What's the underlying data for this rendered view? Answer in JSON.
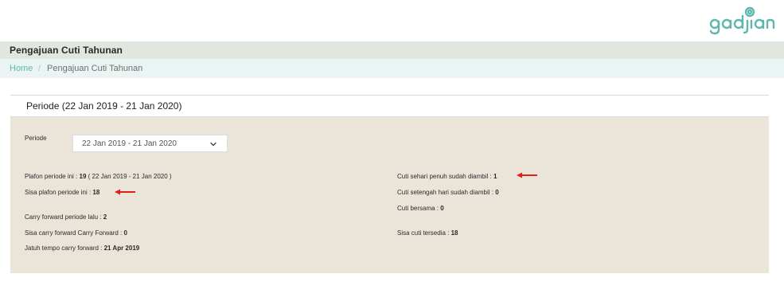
{
  "brand": {
    "logo_text": "gadjian"
  },
  "header": {
    "title": "Pengajuan Cuti Tahunan"
  },
  "breadcrumb": {
    "home": "Home",
    "separator": "/",
    "current": "Pengajuan Cuti Tahunan"
  },
  "card": {
    "title": "Periode (22 Jan 2019 - 21 Jan 2020)",
    "periode_label": "Periode",
    "periode_value": "22 Jan 2019 - 21 Jan 2020",
    "left": {
      "plafon_label": "Plafon periode ini : ",
      "plafon_value": "19",
      "plafon_suffix": " ( 22 Jan 2019 - 21 Jan 2020 )",
      "sisa_plafon_label": "Sisa plafon periode ini : ",
      "sisa_plafon_value": "18",
      "carry_label": "Carry forward periode lalu : ",
      "carry_value": "2",
      "sisa_carry_label": "Sisa carry forward Carry Forward : ",
      "sisa_carry_value": "0",
      "jatuh_label": "Jatuh tempo carry forward : ",
      "jatuh_value": "21 Apr 2019"
    },
    "right": {
      "sehari_label": "Cuti sehari penuh sudah diambil : ",
      "sehari_value": "1",
      "setengah_label": "Cuti setengah hari sudah diambil : ",
      "setengah_value": "0",
      "bersama_label": "Cuti bersama : ",
      "bersama_value": "0",
      "tersedia_label": "Sisa cuti tersedia : ",
      "tersedia_value": "18"
    }
  },
  "colors": {
    "accent": "#5fb7ae",
    "arrow": "#e0201c",
    "panel": "#ebe5d9",
    "titlebar": "#e1e6df",
    "crumbbar": "#e9f4f3"
  },
  "icons": {
    "dropdown": "chevron-down-icon",
    "pointer": "arrow-left-icon"
  }
}
